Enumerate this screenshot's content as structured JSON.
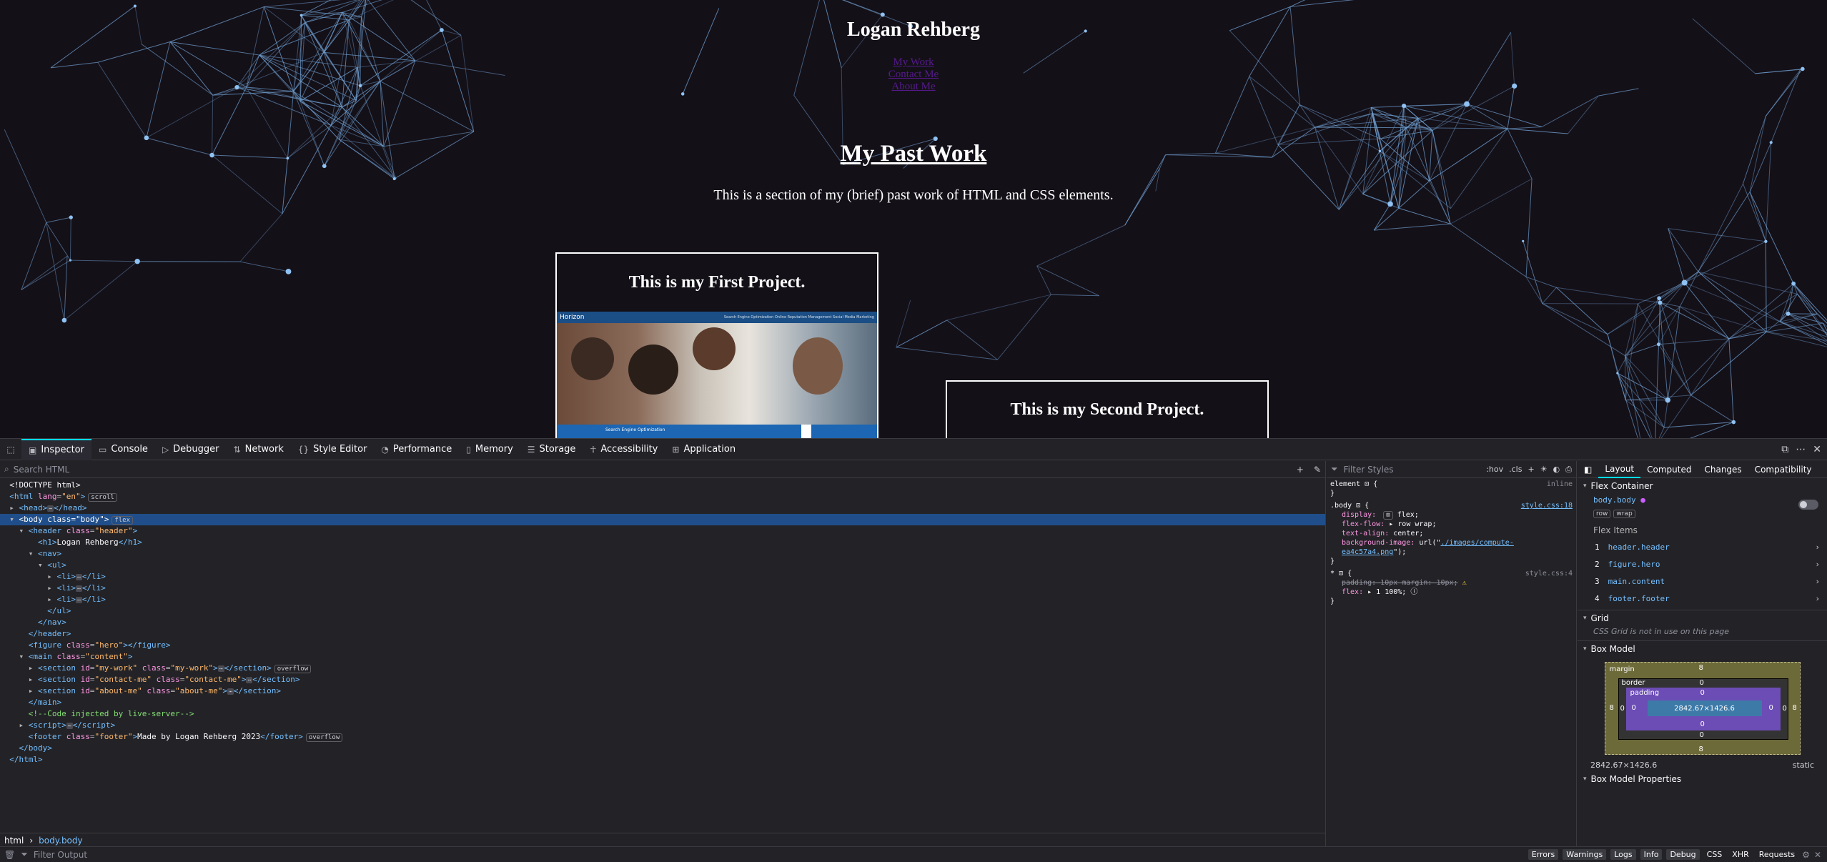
{
  "page": {
    "title": "Logan Rehberg",
    "nav": [
      "My Work",
      "Contact Me",
      "About Me"
    ],
    "section_title": "My Past Work",
    "section_desc": "This is a section of my (brief) past work of HTML and CSS elements.",
    "project1_title": "This is my First Project.",
    "project1_brand": "Horizon",
    "project1_links": "Search Engine Optimization    Online Reputation Management    Social Media Marketing",
    "project1_banner": "Search Engine Optimization",
    "project2_title": "This is my Second Project."
  },
  "toolbar": {
    "tabs": [
      "Inspector",
      "Console",
      "Debugger",
      "Network",
      "Style Editor",
      "Performance",
      "Memory",
      "Storage",
      "Accessibility",
      "Application"
    ],
    "active_tab": "Inspector"
  },
  "markup": {
    "search_placeholder": "Search HTML",
    "breadcrumbs": [
      "html",
      "body.body"
    ]
  },
  "rules": {
    "filter_placeholder": "Filter Styles",
    "hov": ":hov",
    "cls": ".cls",
    "r1_selector": "element",
    "r1_source": "inline",
    "r2_selector": ".body",
    "r2_source": "style.css:18",
    "r2_display_name": "display:",
    "r2_display_val": "flex;",
    "r2_flow_name": "flex-flow:",
    "r2_flow_val": "row wrap;",
    "r2_align_name": "text-align:",
    "r2_align_val": "center;",
    "r2_bg_name": "background-image:",
    "r2_bg_pre": "url(\"",
    "r2_bg_link": "./images/compute-ea4c57a4.png",
    "r2_bg_post": "\");",
    "r3_selector": "*",
    "r3_source": "style.css:4",
    "r3_padding": "padding: 10px margin: 10px;",
    "r3_flex_name": "flex:",
    "r3_flex_val": "1 100%;"
  },
  "layout_panel": {
    "tabs": [
      "Layout",
      "Computed",
      "Changes",
      "Compatibility"
    ],
    "flex_container": "Flex Container",
    "container_name": "body.body",
    "badges": [
      "row",
      "wrap"
    ],
    "flex_items_label": "Flex Items",
    "flex_items": [
      "header.header",
      "figure.hero",
      "main.content",
      "footer.footer"
    ],
    "grid_label": "Grid",
    "grid_note": "CSS Grid is not in use on this page",
    "box_model_label": "Box Model",
    "bm_margin": "margin",
    "bm_border": "border",
    "bm_padding": "padding",
    "bm_content": "2842.67×1426.6",
    "bm_size": "2842.67×1426.6",
    "bm_position": "static",
    "bm_props": "Box Model Properties",
    "bm_zero": "0",
    "bm_eight": "8"
  },
  "console": {
    "filter_placeholder": "Filter Output",
    "buttons": [
      "Errors",
      "Warnings",
      "Logs",
      "Info",
      "Debug"
    ],
    "plain": [
      "CSS",
      "XHR",
      "Requests"
    ]
  }
}
